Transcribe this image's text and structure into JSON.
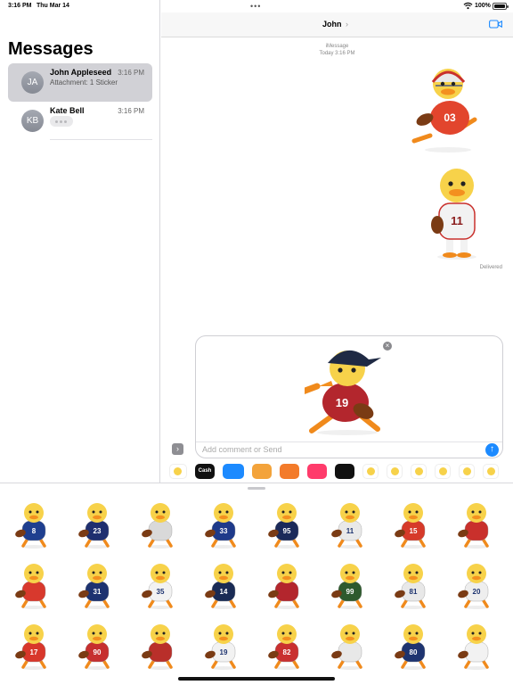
{
  "status_bar": {
    "time": "3:16 PM",
    "date": "Thu Mar 14",
    "battery": "100%"
  },
  "sidebar": {
    "title": "Messages",
    "conversations": [
      {
        "initials": "JA",
        "name": "John Appleseed",
        "time": "3:16 PM",
        "preview": "Attachment: 1 Sticker",
        "selected": true
      },
      {
        "initials": "KB",
        "name": "Kate Bell",
        "time": "3:16 PM",
        "typing": true,
        "selected": false
      }
    ]
  },
  "chat": {
    "contact": "John",
    "service": "iMessage",
    "timestamp": "Today 3:16 PM",
    "delivered": "Delivered",
    "stickers": [
      {
        "jersey": "03",
        "color": "#e2452d"
      },
      {
        "jersey": "11",
        "color": "#f2f2f2"
      }
    ]
  },
  "compose": {
    "placeholder": "Add comment or Send",
    "sticker": {
      "jersey": "19",
      "color": "#b3262d"
    }
  },
  "app_strip": [
    {
      "name": "photos-app",
      "label": "",
      "color": "#ffffff"
    },
    {
      "name": "cash-app",
      "label": "Cash",
      "color": "#111111"
    },
    {
      "name": "audio-app",
      "label": "",
      "color": "#1c8aff"
    },
    {
      "name": "memoji-app",
      "label": "",
      "color": "#f3a33b"
    },
    {
      "name": "stickers-app",
      "label": "",
      "color": "#f37b2a"
    },
    {
      "name": "search-app",
      "label": "",
      "color": "#ff3b6b"
    },
    {
      "name": "digital-touch-app",
      "label": "",
      "color": "#111111"
    },
    {
      "name": "duck-pack-1",
      "label": "",
      "color": "#ffffff"
    },
    {
      "name": "duck-pack-2",
      "label": "",
      "color": "#ffffff"
    },
    {
      "name": "duck-pack-3",
      "label": "",
      "color": "#ffffff"
    },
    {
      "name": "duck-pack-4",
      "label": "",
      "color": "#ffffff"
    },
    {
      "name": "duck-pack-5",
      "label": "",
      "color": "#ffffff"
    },
    {
      "name": "duck-pack-6",
      "label": "",
      "color": "#ffffff"
    }
  ],
  "sticker_grid": [
    {
      "jersey": "8",
      "color": "#1f3f8f"
    },
    {
      "jersey": "23",
      "color": "#1f2f6f"
    },
    {
      "jersey": "",
      "color": "#d9d9d9"
    },
    {
      "jersey": "33",
      "color": "#1e3a8a"
    },
    {
      "jersey": "95",
      "color": "#1b2a5a"
    },
    {
      "jersey": "11",
      "color": "#e9e9e9"
    },
    {
      "jersey": "15",
      "color": "#d63a2a"
    },
    {
      "jersey": "",
      "color": "#c9302c"
    },
    {
      "jersey": "",
      "color": "#d8392d"
    },
    {
      "jersey": "31",
      "color": "#1d3270"
    },
    {
      "jersey": "35",
      "color": "#f2f2f2"
    },
    {
      "jersey": "14",
      "color": "#1a2b55"
    },
    {
      "jersey": "",
      "color": "#b3262d"
    },
    {
      "jersey": "99",
      "color": "#2e5a2e"
    },
    {
      "jersey": "81",
      "color": "#e8e8e8"
    },
    {
      "jersey": "20",
      "color": "#eeeeee"
    },
    {
      "jersey": "17",
      "color": "#d8372b"
    },
    {
      "jersey": "90",
      "color": "#c62f2f"
    },
    {
      "jersey": "",
      "color": "#b92f2a"
    },
    {
      "jersey": "19",
      "color": "#f2f2f2"
    },
    {
      "jersey": "82",
      "color": "#c93030"
    },
    {
      "jersey": "",
      "color": "#e8e8e8"
    },
    {
      "jersey": "80",
      "color": "#1e3470"
    },
    {
      "jersey": "",
      "color": "#f2f2f2"
    }
  ]
}
